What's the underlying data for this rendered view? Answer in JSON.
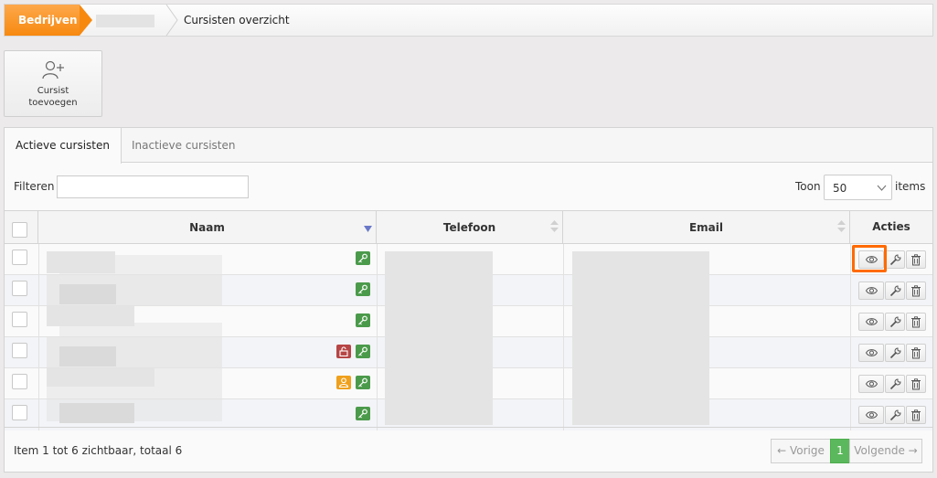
{
  "breadcrumb": {
    "home": "Bedrijven",
    "current": "Cursisten overzicht"
  },
  "toolbar": {
    "add_student": "Cursist\ntoevoegen"
  },
  "tabs": [
    {
      "label": "Actieve cursisten",
      "active": true
    },
    {
      "label": "Inactieve cursisten",
      "active": false
    }
  ],
  "filter": {
    "label": "Filteren",
    "value": ""
  },
  "page_size": {
    "label_before": "Toon",
    "value": "50",
    "label_after": "items"
  },
  "table": {
    "columns": [
      "Naam",
      "Telefoon",
      "Email",
      "Acties"
    ],
    "sorted_column": "Naam",
    "rows": [
      {
        "badges": [
          "key-icon"
        ]
      },
      {
        "badges": [
          "key-icon"
        ]
      },
      {
        "badges": [
          "key-icon"
        ]
      },
      {
        "badges": [
          "unlock-icon",
          "key-icon"
        ]
      },
      {
        "badges": [
          "user-icon",
          "key-icon"
        ]
      },
      {
        "badges": [
          "key-icon"
        ]
      }
    ],
    "actions": [
      "eye-icon",
      "wrench-icon",
      "trash-icon"
    ]
  },
  "footer": {
    "summary": "Item 1 tot 6 zichtbaar, totaal 6",
    "prev": "← Vorige",
    "current_page": "1",
    "next": "Volgende →"
  },
  "colors": {
    "accent": "#f7890f",
    "badge_green": "#4b9a4b",
    "badge_red": "#b64545",
    "badge_orange": "#efa01c",
    "highlight": "#ff6a00",
    "page_active": "#5cb85c"
  }
}
